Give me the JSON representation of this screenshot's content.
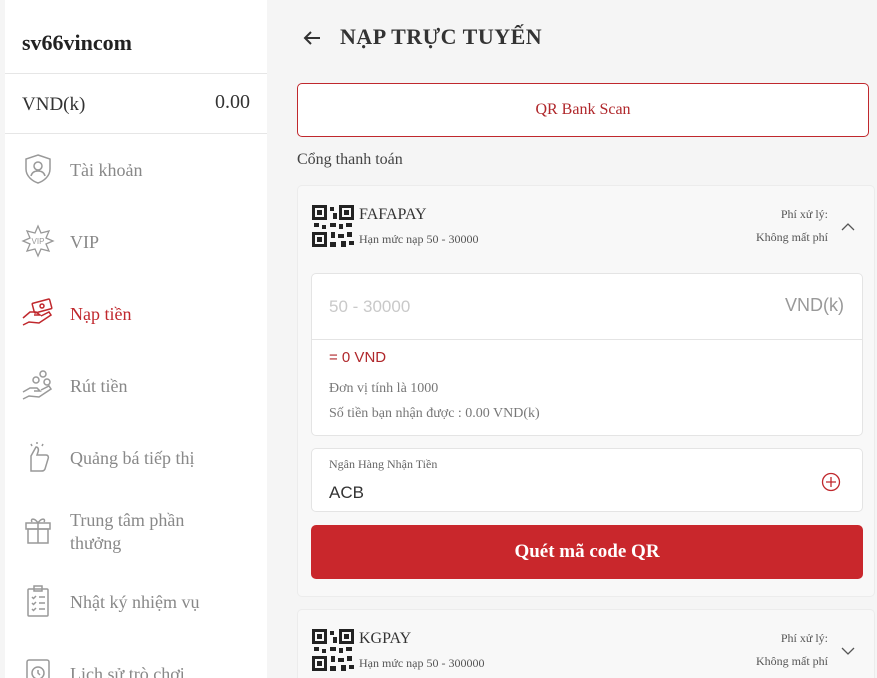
{
  "sidebar": {
    "username": "sv66vincom",
    "balance_label": "VND(k)",
    "balance_value": "0.00",
    "items": [
      {
        "label": "Tài khoản",
        "icon": "account-shield-icon"
      },
      {
        "label": "VIP",
        "icon": "vip-star-icon"
      },
      {
        "label": "Nạp tiền",
        "icon": "deposit-hand-icon",
        "active": true
      },
      {
        "label": "Rút tiền",
        "icon": "withdraw-hand-coins-icon"
      },
      {
        "label": "Quảng bá tiếp thị",
        "icon": "marketing-thumb-icon"
      },
      {
        "label": "Trung tâm phần thưởng",
        "icon": "gift-icon"
      },
      {
        "label": "Nhật ký nhiệm vụ",
        "icon": "clipboard-list-icon"
      },
      {
        "label": "Lịch sử trò chơi",
        "icon": "game-history-icon"
      }
    ]
  },
  "header": {
    "title": "NẠP TRỰC TUYẾN"
  },
  "qr_bank_button": "QR Bank Scan",
  "gateway_section_label": "Cổng thanh toán",
  "gateways": [
    {
      "name": "FAFAPAY",
      "limit": "Hạn mức nạp 50 - 30000",
      "fee_label": "Phí xử lý:",
      "fee_value": "Không mất phí",
      "expanded": true
    },
    {
      "name": "KGPAY",
      "limit": "Hạn mức nạp 50 - 300000",
      "fee_label": "Phí xử lý:",
      "fee_value": "Không mất phí",
      "expanded": false
    }
  ],
  "deposit_form": {
    "amount_placeholder": "50 - 30000",
    "amount_unit": "VND(k)",
    "converted": "= 0 VND",
    "unit_note": "Đơn vị tính là 1000",
    "receive_note": "Số tiền bạn nhận được : 0.00 VND(k)",
    "bank_label": "Ngân Hàng Nhận Tiền",
    "bank_value": "ACB",
    "submit_label": "Quét mã code QR"
  },
  "colors": {
    "accent": "#c9272c",
    "accent_text": "#b0272b",
    "muted_text": "#888888"
  }
}
